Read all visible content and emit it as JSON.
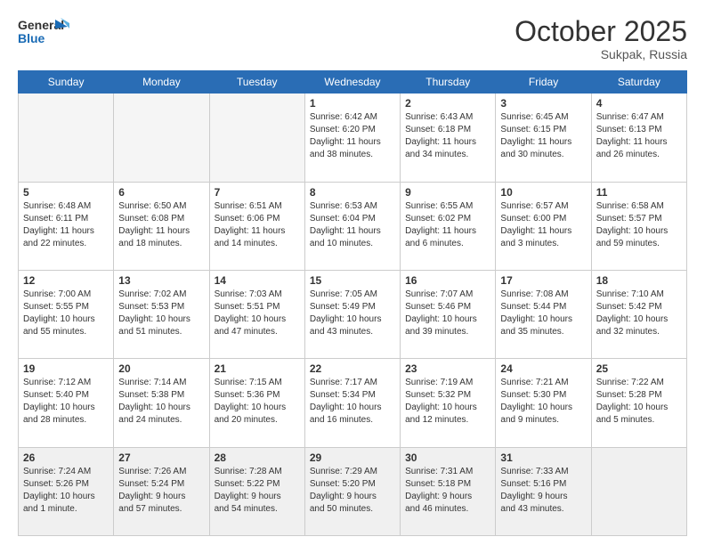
{
  "header": {
    "logo_line1": "General",
    "logo_line2": "Blue",
    "month": "October 2025",
    "location": "Sukpak, Russia"
  },
  "days_of_week": [
    "Sunday",
    "Monday",
    "Tuesday",
    "Wednesday",
    "Thursday",
    "Friday",
    "Saturday"
  ],
  "weeks": [
    [
      {
        "day": "",
        "info": ""
      },
      {
        "day": "",
        "info": ""
      },
      {
        "day": "",
        "info": ""
      },
      {
        "day": "1",
        "info": "Sunrise: 6:42 AM\nSunset: 6:20 PM\nDaylight: 11 hours\nand 38 minutes."
      },
      {
        "day": "2",
        "info": "Sunrise: 6:43 AM\nSunset: 6:18 PM\nDaylight: 11 hours\nand 34 minutes."
      },
      {
        "day": "3",
        "info": "Sunrise: 6:45 AM\nSunset: 6:15 PM\nDaylight: 11 hours\nand 30 minutes."
      },
      {
        "day": "4",
        "info": "Sunrise: 6:47 AM\nSunset: 6:13 PM\nDaylight: 11 hours\nand 26 minutes."
      }
    ],
    [
      {
        "day": "5",
        "info": "Sunrise: 6:48 AM\nSunset: 6:11 PM\nDaylight: 11 hours\nand 22 minutes."
      },
      {
        "day": "6",
        "info": "Sunrise: 6:50 AM\nSunset: 6:08 PM\nDaylight: 11 hours\nand 18 minutes."
      },
      {
        "day": "7",
        "info": "Sunrise: 6:51 AM\nSunset: 6:06 PM\nDaylight: 11 hours\nand 14 minutes."
      },
      {
        "day": "8",
        "info": "Sunrise: 6:53 AM\nSunset: 6:04 PM\nDaylight: 11 hours\nand 10 minutes."
      },
      {
        "day": "9",
        "info": "Sunrise: 6:55 AM\nSunset: 6:02 PM\nDaylight: 11 hours\nand 6 minutes."
      },
      {
        "day": "10",
        "info": "Sunrise: 6:57 AM\nSunset: 6:00 PM\nDaylight: 11 hours\nand 3 minutes."
      },
      {
        "day": "11",
        "info": "Sunrise: 6:58 AM\nSunset: 5:57 PM\nDaylight: 10 hours\nand 59 minutes."
      }
    ],
    [
      {
        "day": "12",
        "info": "Sunrise: 7:00 AM\nSunset: 5:55 PM\nDaylight: 10 hours\nand 55 minutes."
      },
      {
        "day": "13",
        "info": "Sunrise: 7:02 AM\nSunset: 5:53 PM\nDaylight: 10 hours\nand 51 minutes."
      },
      {
        "day": "14",
        "info": "Sunrise: 7:03 AM\nSunset: 5:51 PM\nDaylight: 10 hours\nand 47 minutes."
      },
      {
        "day": "15",
        "info": "Sunrise: 7:05 AM\nSunset: 5:49 PM\nDaylight: 10 hours\nand 43 minutes."
      },
      {
        "day": "16",
        "info": "Sunrise: 7:07 AM\nSunset: 5:46 PM\nDaylight: 10 hours\nand 39 minutes."
      },
      {
        "day": "17",
        "info": "Sunrise: 7:08 AM\nSunset: 5:44 PM\nDaylight: 10 hours\nand 35 minutes."
      },
      {
        "day": "18",
        "info": "Sunrise: 7:10 AM\nSunset: 5:42 PM\nDaylight: 10 hours\nand 32 minutes."
      }
    ],
    [
      {
        "day": "19",
        "info": "Sunrise: 7:12 AM\nSunset: 5:40 PM\nDaylight: 10 hours\nand 28 minutes."
      },
      {
        "day": "20",
        "info": "Sunrise: 7:14 AM\nSunset: 5:38 PM\nDaylight: 10 hours\nand 24 minutes."
      },
      {
        "day": "21",
        "info": "Sunrise: 7:15 AM\nSunset: 5:36 PM\nDaylight: 10 hours\nand 20 minutes."
      },
      {
        "day": "22",
        "info": "Sunrise: 7:17 AM\nSunset: 5:34 PM\nDaylight: 10 hours\nand 16 minutes."
      },
      {
        "day": "23",
        "info": "Sunrise: 7:19 AM\nSunset: 5:32 PM\nDaylight: 10 hours\nand 12 minutes."
      },
      {
        "day": "24",
        "info": "Sunrise: 7:21 AM\nSunset: 5:30 PM\nDaylight: 10 hours\nand 9 minutes."
      },
      {
        "day": "25",
        "info": "Sunrise: 7:22 AM\nSunset: 5:28 PM\nDaylight: 10 hours\nand 5 minutes."
      }
    ],
    [
      {
        "day": "26",
        "info": "Sunrise: 7:24 AM\nSunset: 5:26 PM\nDaylight: 10 hours\nand 1 minute."
      },
      {
        "day": "27",
        "info": "Sunrise: 7:26 AM\nSunset: 5:24 PM\nDaylight: 9 hours\nand 57 minutes."
      },
      {
        "day": "28",
        "info": "Sunrise: 7:28 AM\nSunset: 5:22 PM\nDaylight: 9 hours\nand 54 minutes."
      },
      {
        "day": "29",
        "info": "Sunrise: 7:29 AM\nSunset: 5:20 PM\nDaylight: 9 hours\nand 50 minutes."
      },
      {
        "day": "30",
        "info": "Sunrise: 7:31 AM\nSunset: 5:18 PM\nDaylight: 9 hours\nand 46 minutes."
      },
      {
        "day": "31",
        "info": "Sunrise: 7:33 AM\nSunset: 5:16 PM\nDaylight: 9 hours\nand 43 minutes."
      },
      {
        "day": "",
        "info": ""
      }
    ]
  ]
}
